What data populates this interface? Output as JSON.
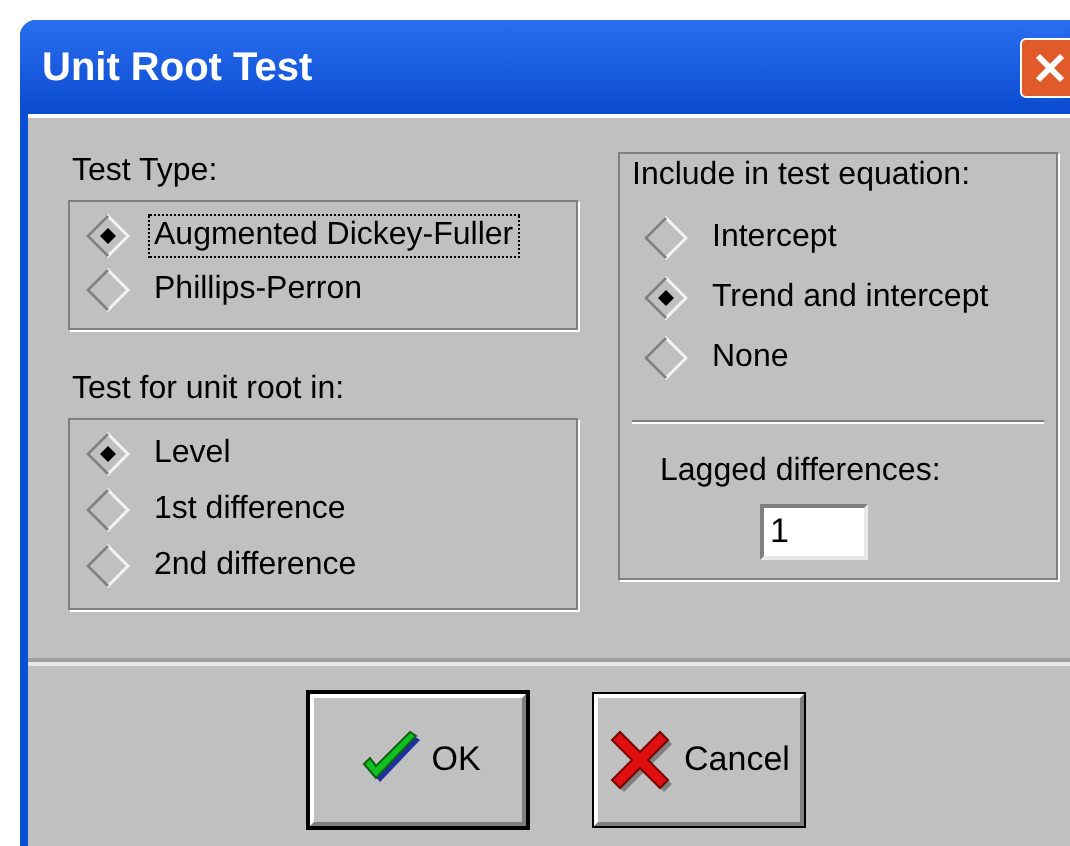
{
  "window": {
    "title": "Unit Root Test"
  },
  "test_type": {
    "label": "Test Type:",
    "options": [
      {
        "label": "Augmented Dickey-Fuller",
        "selected": true,
        "focused": true
      },
      {
        "label": "Phillips-Perron",
        "selected": false,
        "focused": false
      }
    ]
  },
  "test_for": {
    "label": "Test for unit root in:",
    "options": [
      {
        "label": "Level",
        "selected": true
      },
      {
        "label": "1st difference",
        "selected": false
      },
      {
        "label": "2nd difference",
        "selected": false
      }
    ]
  },
  "include": {
    "label": "Include in test equation:",
    "options": [
      {
        "label": "Intercept",
        "selected": false
      },
      {
        "label": "Trend and intercept",
        "selected": true
      },
      {
        "label": "None",
        "selected": false
      }
    ]
  },
  "lagged": {
    "label": "Lagged differences:",
    "value": "1"
  },
  "buttons": [
    {
      "kind": "ok",
      "label": "OK",
      "default": true
    },
    {
      "kind": "cancel",
      "label": "Cancel",
      "default": false
    }
  ]
}
